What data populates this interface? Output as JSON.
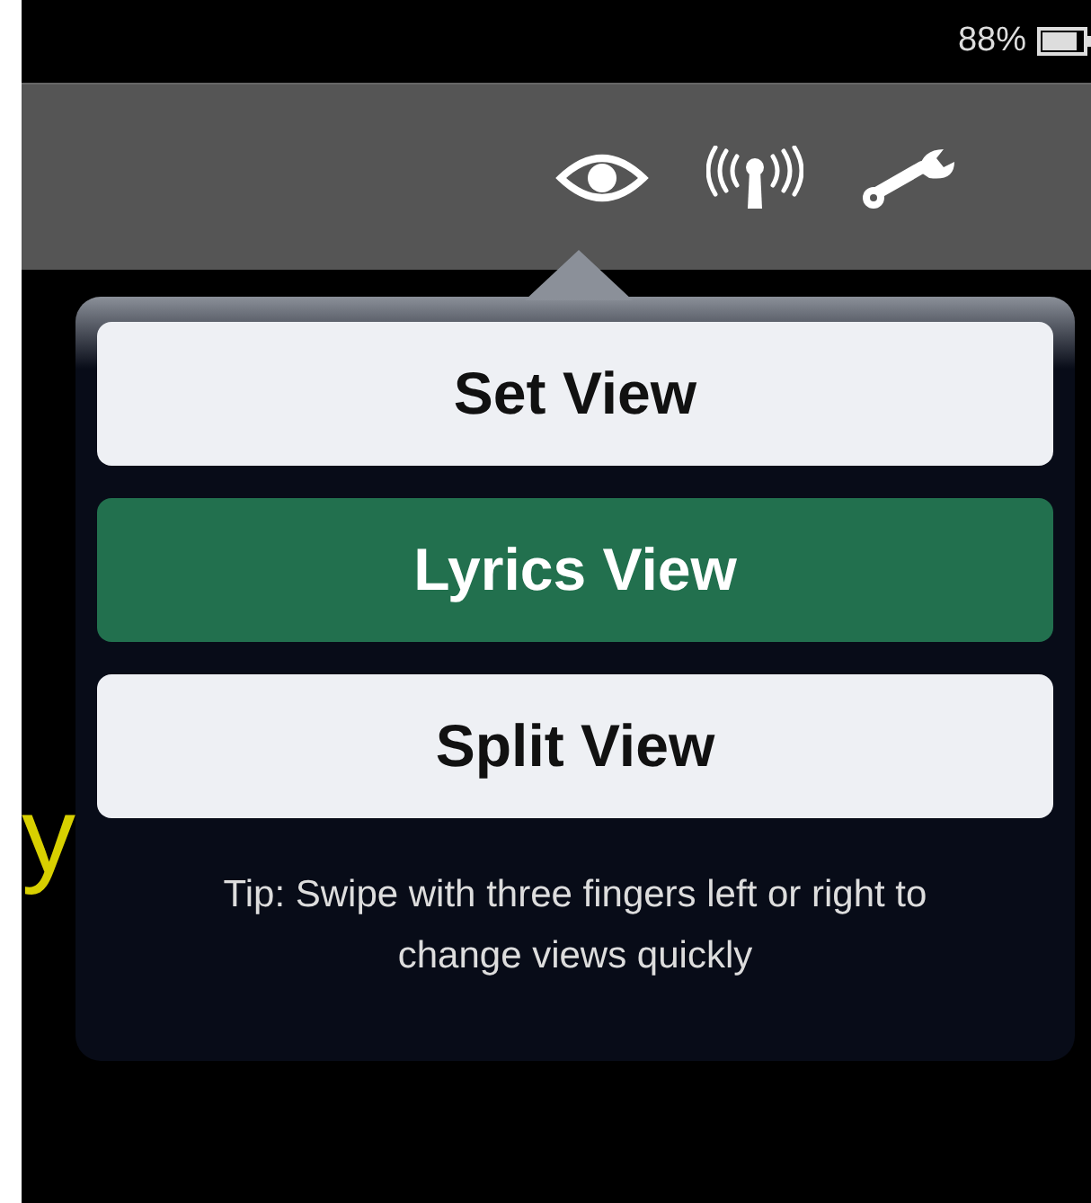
{
  "status_bar": {
    "battery": "88%"
  },
  "lyrics": {
    "text": "y"
  },
  "view_menu": {
    "options": [
      {
        "label": "Set View",
        "selected": false
      },
      {
        "label": "Lyrics View",
        "selected": true
      },
      {
        "label": "Split View",
        "selected": false
      }
    ],
    "tip": "Tip: Swipe with three fingers left or right to change views quickly"
  }
}
